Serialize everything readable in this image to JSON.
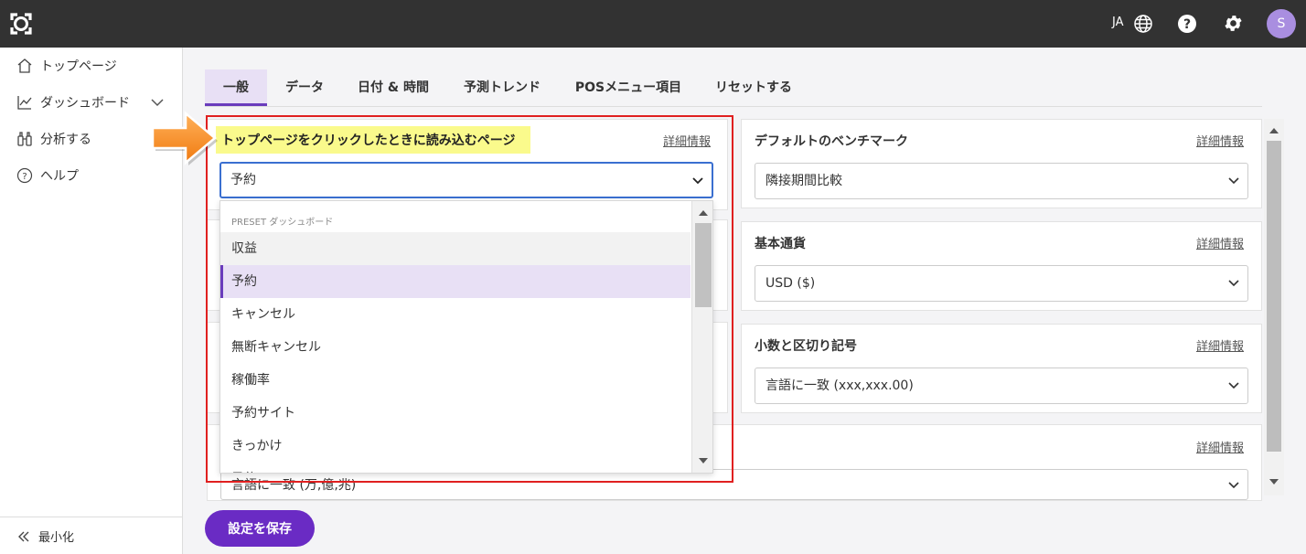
{
  "topbar": {
    "lang_label": "JA",
    "avatar_initial": "S"
  },
  "sidebar": {
    "items": [
      {
        "label": "トップページ",
        "icon": "home-icon"
      },
      {
        "label": "ダッシュボード",
        "icon": "chart-icon"
      },
      {
        "label": "分析する",
        "icon": "binoculars-icon"
      },
      {
        "label": "ヘルプ",
        "icon": "help-circle-icon"
      }
    ],
    "minimize_label": "最小化"
  },
  "tabs": [
    "一般",
    "データ",
    "日付 & 時間",
    "予測トレンド",
    "POSメニュー項目",
    "リセットする"
  ],
  "active_tab": "一般",
  "left_card": {
    "title": "トップページをクリックしたときに読み込むページ",
    "link": "詳細情報",
    "select_value": "予約",
    "bottom_select_value": "言語に一致 (万,億,兆)"
  },
  "dropdown": {
    "group_label": "PRESET ダッシュボード",
    "items": [
      "収益",
      "予約",
      "キャンセル",
      "無断キャンセル",
      "稼働率",
      "予約サイト",
      "きっかけ",
      "予約..."
    ],
    "selected": "予約"
  },
  "right_cards": [
    {
      "title": "デフォルトのベンチマーク",
      "link": "詳細情報",
      "value": "隣接期間比較"
    },
    {
      "title": "基本通貨",
      "link": "詳細情報",
      "value": "USD ($)"
    },
    {
      "title": "小数と区切り記号",
      "link": "詳細情報",
      "value": "言語に一致 (xxx,xxx.00)"
    },
    {
      "title": "",
      "link": "詳細情報",
      "value": ""
    }
  ],
  "save_button": "設定を保存",
  "colors": {
    "accent": "#6a2bc4",
    "topbar": "#323232",
    "annotation_red": "#e02020",
    "highlight": "#fafa8c"
  }
}
